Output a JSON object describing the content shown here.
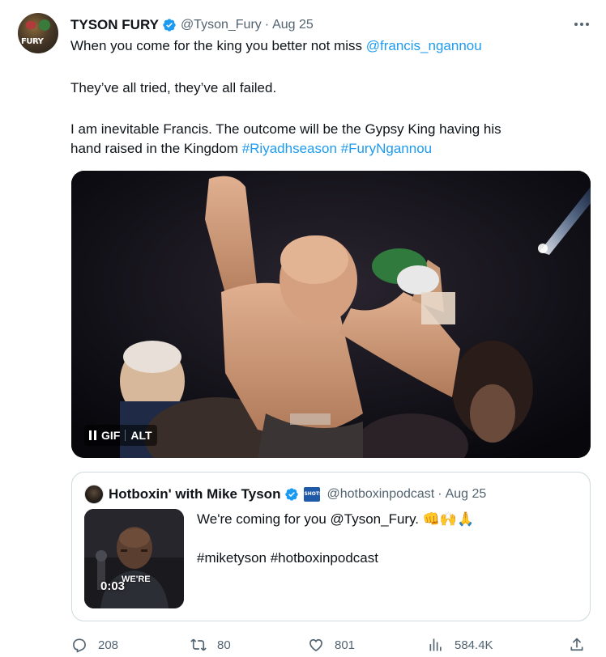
{
  "tweet": {
    "author": {
      "display_name": "TYSON FURY",
      "handle": "@Tyson_Fury",
      "date": "Aug 25",
      "avatar_label": "FURY"
    },
    "separator": "·",
    "text": {
      "line1_prefix": "When you come for the king you better not miss ",
      "line1_mention": "@francis_ngannou",
      "line2": "They’ve all tried, they’ve all failed.",
      "line3": "I am inevitable Francis. The outcome will be the Gypsy King having his",
      "line4_prefix": "hand raised in the Kingdom ",
      "hashtag1": "#Riyadhseason",
      "hashtag2": "#FuryNgannou"
    },
    "media": {
      "gif_label": "GIF",
      "alt_label": "ALT"
    }
  },
  "quote": {
    "author": {
      "display_name": "Hotboxin' with Mike Tyson",
      "badge_label": "SHOTS",
      "handle": "@hotboxinpodcast",
      "date": "Aug 25"
    },
    "separator": "·",
    "text_line1": "We're coming for you @Tyson_Fury. 👊🙌🙏",
    "text_line2": "#miketyson #hotboxinpodcast",
    "video_time": "0:03",
    "video_caption": "WE'RE"
  },
  "actions": {
    "replies": "208",
    "reposts": "80",
    "likes": "801",
    "views": "584.4K"
  },
  "colors": {
    "link": "#1d9bf0",
    "verified": "#1d9bf0",
    "secondary_text": "#536471",
    "border": "#cfd9de"
  }
}
